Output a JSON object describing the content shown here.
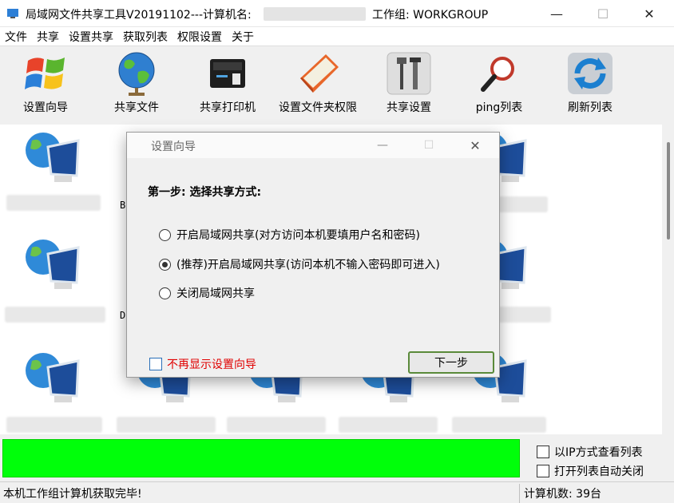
{
  "window": {
    "title": "局域网文件共享工具V20191102---计算机名:",
    "workgroup_text": "工作组: WORKGROUP",
    "minimize": "—",
    "maximize": "☐",
    "close": "✕"
  },
  "menu": [
    "文件",
    "共享",
    "设置共享",
    "获取列表",
    "权限设置",
    "关于"
  ],
  "toolbar": [
    {
      "label": "设置向导",
      "icon": "windows-logo-icon"
    },
    {
      "label": "共享文件",
      "icon": "globe-icon"
    },
    {
      "label": "共享打印机",
      "icon": "printer-icon"
    },
    {
      "label": "设置文件夹权限",
      "icon": "folder-book-icon"
    },
    {
      "label": "共享设置",
      "icon": "tools-icon"
    },
    {
      "label": "ping列表",
      "icon": "magnifier-icon"
    },
    {
      "label": "刷新列表",
      "icon": "refresh-icon"
    }
  ],
  "list": {
    "stray_chars": [
      "B",
      "D"
    ]
  },
  "options": {
    "view_by_ip": "以IP方式查看列表",
    "auto_close": "打开列表自动关闭"
  },
  "status": {
    "left": "本机工作组计算机获取完毕!",
    "right": "计算机数: 39台"
  },
  "dialog": {
    "title": "设置向导",
    "minimize": "—",
    "maximize": "☐",
    "close": "✕",
    "step": "第一步: 选择共享方式:",
    "options": [
      {
        "label": "开启局域网共享(对方访问本机要填用户名和密码)",
        "selected": false
      },
      {
        "label": "(推荐)开启局域网共享(访问本机不输入密码即可进入)",
        "selected": true
      },
      {
        "label": "关闭局域网共享",
        "selected": false
      }
    ],
    "dont_show": "不再显示设置向导",
    "next": "下一步"
  },
  "colors": {
    "progress": "#00ff0a",
    "warning_text": "#e00000"
  }
}
